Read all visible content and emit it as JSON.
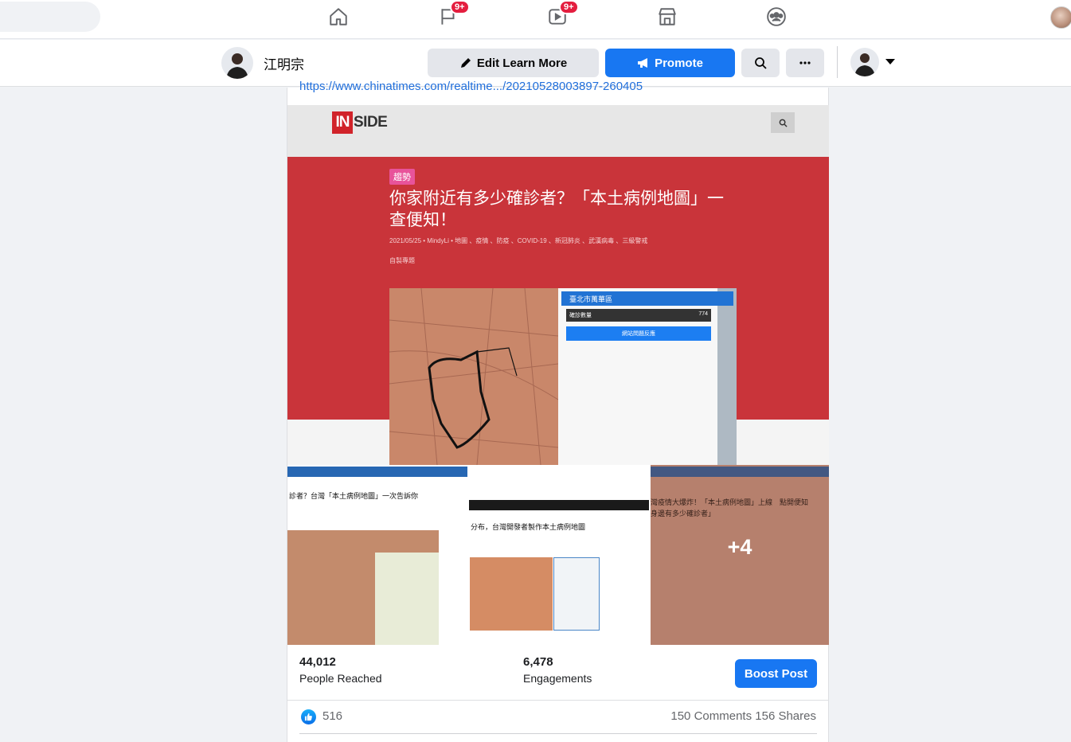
{
  "topnav": {
    "items": [
      {
        "name": "home-icon"
      },
      {
        "name": "flag-icon",
        "badge": "9+"
      },
      {
        "name": "video-icon",
        "badge": "9+"
      },
      {
        "name": "marketplace-icon"
      },
      {
        "name": "groups-icon"
      }
    ]
  },
  "page": {
    "name": "江明宗",
    "edit_button": "Edit Learn More",
    "promote_button": "Promote"
  },
  "post": {
    "link": "https://www.chinatimes.com/realtime.../20210528003897-260405",
    "hero": {
      "site_logo_in": "IN",
      "site_logo_side": "SIDE",
      "tag": "趨勢",
      "title": "你家附近有多少確診者？「本土病例地圖」一查便知！",
      "meta": "2021/05/25 • MindyLi • 地圖 、疫情 、防疫 、COVID-19 、新冠肺炎 、武漢病毒 、三級警戒",
      "sub": "自製專題",
      "map_panel_title": "臺北市萬華區",
      "map_row_label": "確診數量",
      "map_row_value": "774",
      "map_button": "網站問題反應"
    },
    "thumbs": [
      {
        "headline": "診者？台灣「本土病例地圖」一次告訴你"
      },
      {
        "headline": "分布，台灣開發者製作本土病例地圖"
      },
      {
        "headline": "灣疫情大爆炸！「本土病例地圖」上線　點開便知",
        "headline2": "身邊有多少確診者」",
        "more": "+4"
      }
    ],
    "stats": {
      "reached_value": "44,012",
      "reached_label": "People Reached",
      "engagements_value": "6,478",
      "engagements_label": "Engagements",
      "boost_button": "Boost Post"
    },
    "reactions": {
      "likes": "516",
      "comments": "150 Comments",
      "shares": "156 Shares"
    }
  },
  "colors": {
    "brand_blue": "#1877f2",
    "hero_red": "#c9343a",
    "badge_red": "#e41e3f"
  }
}
